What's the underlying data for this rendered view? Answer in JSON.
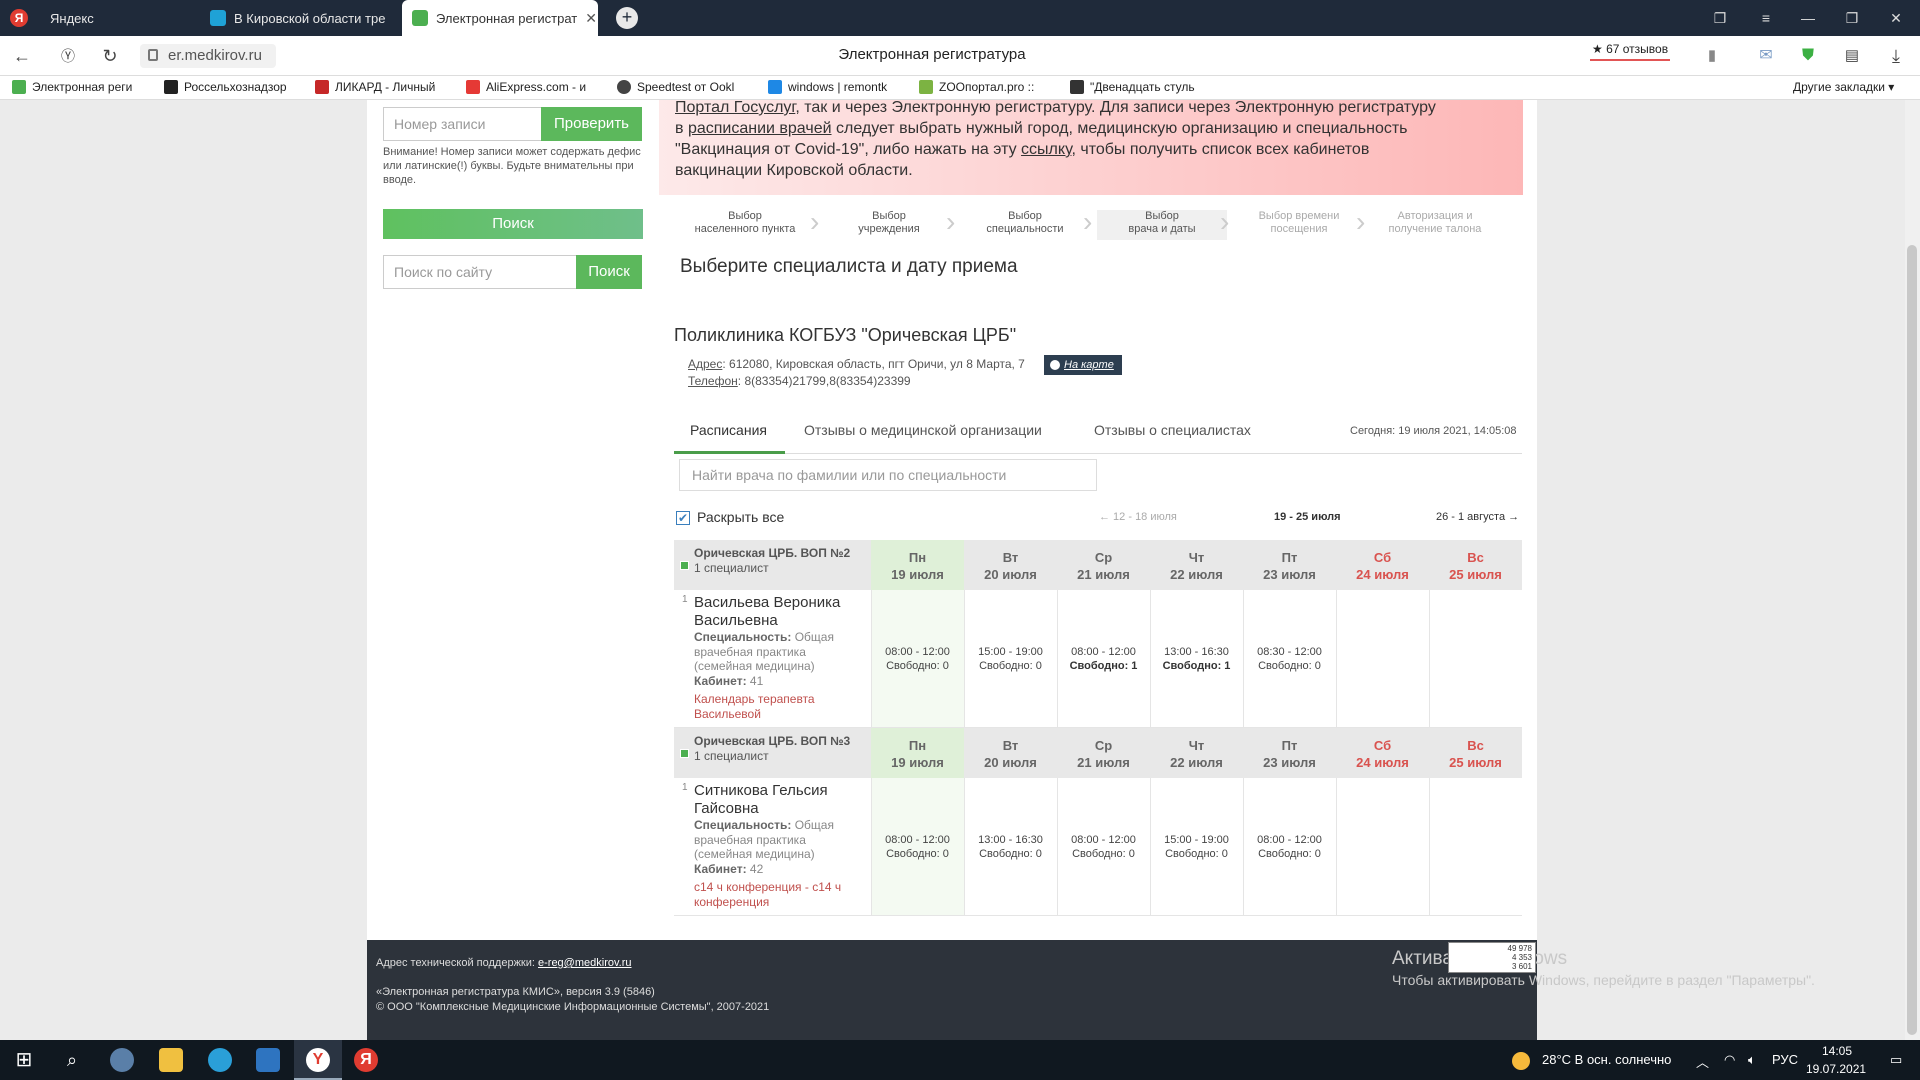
{
  "browser": {
    "tabs": [
      {
        "label": "Яндекс",
        "icon": "yandex-icon",
        "color": "#e03c31"
      },
      {
        "label": "В Кировской области тре",
        "icon": "news-icon",
        "color": "#1fa2d6"
      },
      {
        "label": "Электронная регистрат",
        "icon": "medkirov-icon",
        "color": "#4caf50",
        "active": true
      }
    ],
    "url": "er.medkirov.ru",
    "page_title": "Электронная регистратура",
    "reviews": "★ 67 отзывов",
    "bookmarks": [
      {
        "label": "Электронная реги",
        "color": "#4caf50"
      },
      {
        "label": "Россельхознадзор",
        "color": "#222222"
      },
      {
        "label": "ЛИКАРД - Личный",
        "color": "#c62828"
      },
      {
        "label": "AliExpress.com - и",
        "color": "#e53935"
      },
      {
        "label": "Speedtest от Ookl",
        "color": "#444444"
      },
      {
        "label": "windows | remontk",
        "color": "#1e88e5"
      },
      {
        "label": "ZOOпортал.pro ::",
        "color": "#7cb342"
      },
      {
        "label": "\"Двенадцать стуль",
        "color": "#333333"
      }
    ],
    "other_bookmarks": "Другие закладки ▾"
  },
  "sidebar": {
    "record_placeholder": "Номер записи",
    "check_button": "Проверить",
    "notice": "Внимание! Номер записи может содержать дефис или латинские(!) буквы. Будьте внимательны при вводе.",
    "search_button": "Поиск",
    "site_search_placeholder": "Поиск по сайту",
    "site_search_button": "Поиск"
  },
  "banner": {
    "line1_link": "Портал Госуслуг",
    "line1_rest": ", так и через Электронную регистратуру. Для записи через Электронную регистратуру",
    "line2_pre": "в ",
    "line2_link": "расписании врачей",
    "line2_rest": " следует выбрать нужный город, медицинскую организацию и специальность",
    "line3_pre": "\"Вакцинация от Covid-19\", либо нажать на эту ",
    "line3_link": "ссылку",
    "line3_rest": ", чтобы получить список всех кабинетов",
    "line4": "вакцинации Кировской области."
  },
  "steps": [
    {
      "l1": "Выбор",
      "l2": "населенного пункта",
      "faded": false
    },
    {
      "l1": "Выбор",
      "l2": "учреждения",
      "faded": false
    },
    {
      "l1": "Выбор",
      "l2": "специальности",
      "faded": false
    },
    {
      "l1": "Выбор",
      "l2": "врача и даты",
      "faded": false
    },
    {
      "l1": "Выбор времени",
      "l2": "посещения",
      "faded": true
    },
    {
      "l1": "Авторизация и",
      "l2": "получение талона",
      "faded": true
    }
  ],
  "step_title": "Выберите специалиста и дату приема",
  "clinic": {
    "name": "Поликлиника КОГБУЗ \"Оричевская ЦРБ\"",
    "address_label": "Адрес",
    "address": ": 612080, Кировская область, пгт Оричи, ул 8 Марта, 7",
    "map_button": "На карте",
    "phone_label": "Телефон",
    "phone": ": 8(83354)21799,8(83354)23399"
  },
  "tabs": [
    "Расписания",
    "Отзывы о медицинской организации",
    "Отзывы о специалистах"
  ],
  "today": "Сегодня: 19 июля 2021, 14:05:08",
  "doctor_search_placeholder": "Найти врача по фамилии или по специальности",
  "expand_all": "Раскрыть все",
  "week_nav": {
    "prev": "← 12 - 18 июля",
    "current": "19 - 25 июля",
    "next": "26 - 1 августа →"
  },
  "days": [
    {
      "d": "Пн",
      "date": "19 июля"
    },
    {
      "d": "Вт",
      "date": "20 июля"
    },
    {
      "d": "Ср",
      "date": "21 июля"
    },
    {
      "d": "Чт",
      "date": "22 июля"
    },
    {
      "d": "Пт",
      "date": "23 июля"
    },
    {
      "d": "Сб",
      "date": "24 июля"
    },
    {
      "d": "Вс",
      "date": "25 июля"
    }
  ],
  "groups": [
    {
      "name": "Оричевская ЦРБ. ВОП №2",
      "count": "1 специалист",
      "doctor": {
        "num": "1",
        "name": "Васильева Вероника Васильевна",
        "spec_label": "Специальность:",
        "spec": " Общая врачебная практика (семейная медицина)",
        "room_label": "Кабинет:",
        "room": " 41",
        "link": "Календарь терапевта Васильевой",
        "slots": [
          {
            "time": "08:00 - 12:00",
            "free": "Свободно: 0"
          },
          {
            "time": "15:00 - 19:00",
            "free": "Свободно: 0"
          },
          {
            "time": "08:00 - 12:00",
            "free": "Свободно: 1"
          },
          {
            "time": "13:00 - 16:30",
            "free": "Свободно: 1"
          },
          {
            "time": "08:30 - 12:00",
            "free": "Свободно: 0"
          }
        ]
      }
    },
    {
      "name": "Оричевская ЦРБ. ВОП №3",
      "count": "1 специалист",
      "doctor": {
        "num": "1",
        "name": "Ситникова Гельсия Гайсовна",
        "spec_label": "Специальность:",
        "spec": " Общая врачебная практика (семейная медицина)",
        "room_label": "Кабинет:",
        "room": " 42",
        "link": "с14 ч конференция - с14 ч конференция",
        "slots": [
          {
            "time": "08:00 - 12:00",
            "free": "Свободно: 0"
          },
          {
            "time": "13:00 - 16:30",
            "free": "Свободно: 0"
          },
          {
            "time": "08:00 - 12:00",
            "free": "Свободно: 0"
          },
          {
            "time": "15:00 - 19:00",
            "free": "Свободно: 0"
          },
          {
            "time": "08:00 - 12:00",
            "free": "Свободно: 0"
          }
        ]
      }
    }
  ],
  "footer": {
    "support_label": "Адрес технической поддержки: ",
    "support_email": "e-reg@medkirov.ru",
    "version": "«Электронная регистратура КМИС», версия 3.9 (5846)",
    "copyright": "© ООО \"Комплексные Медицинские Информационные Системы\", 2007-2021",
    "counter": [
      "49 978",
      "4 353",
      "3 601"
    ]
  },
  "watermark": {
    "line1": "Активация Windows",
    "line2": "Чтобы активировать Windows, перейдите в раздел \"Параметры\"."
  },
  "taskbar": {
    "weather": "28°C  В осн. солнечно",
    "lang": "РУС",
    "time": "14:05",
    "date": "19.07.2021"
  }
}
